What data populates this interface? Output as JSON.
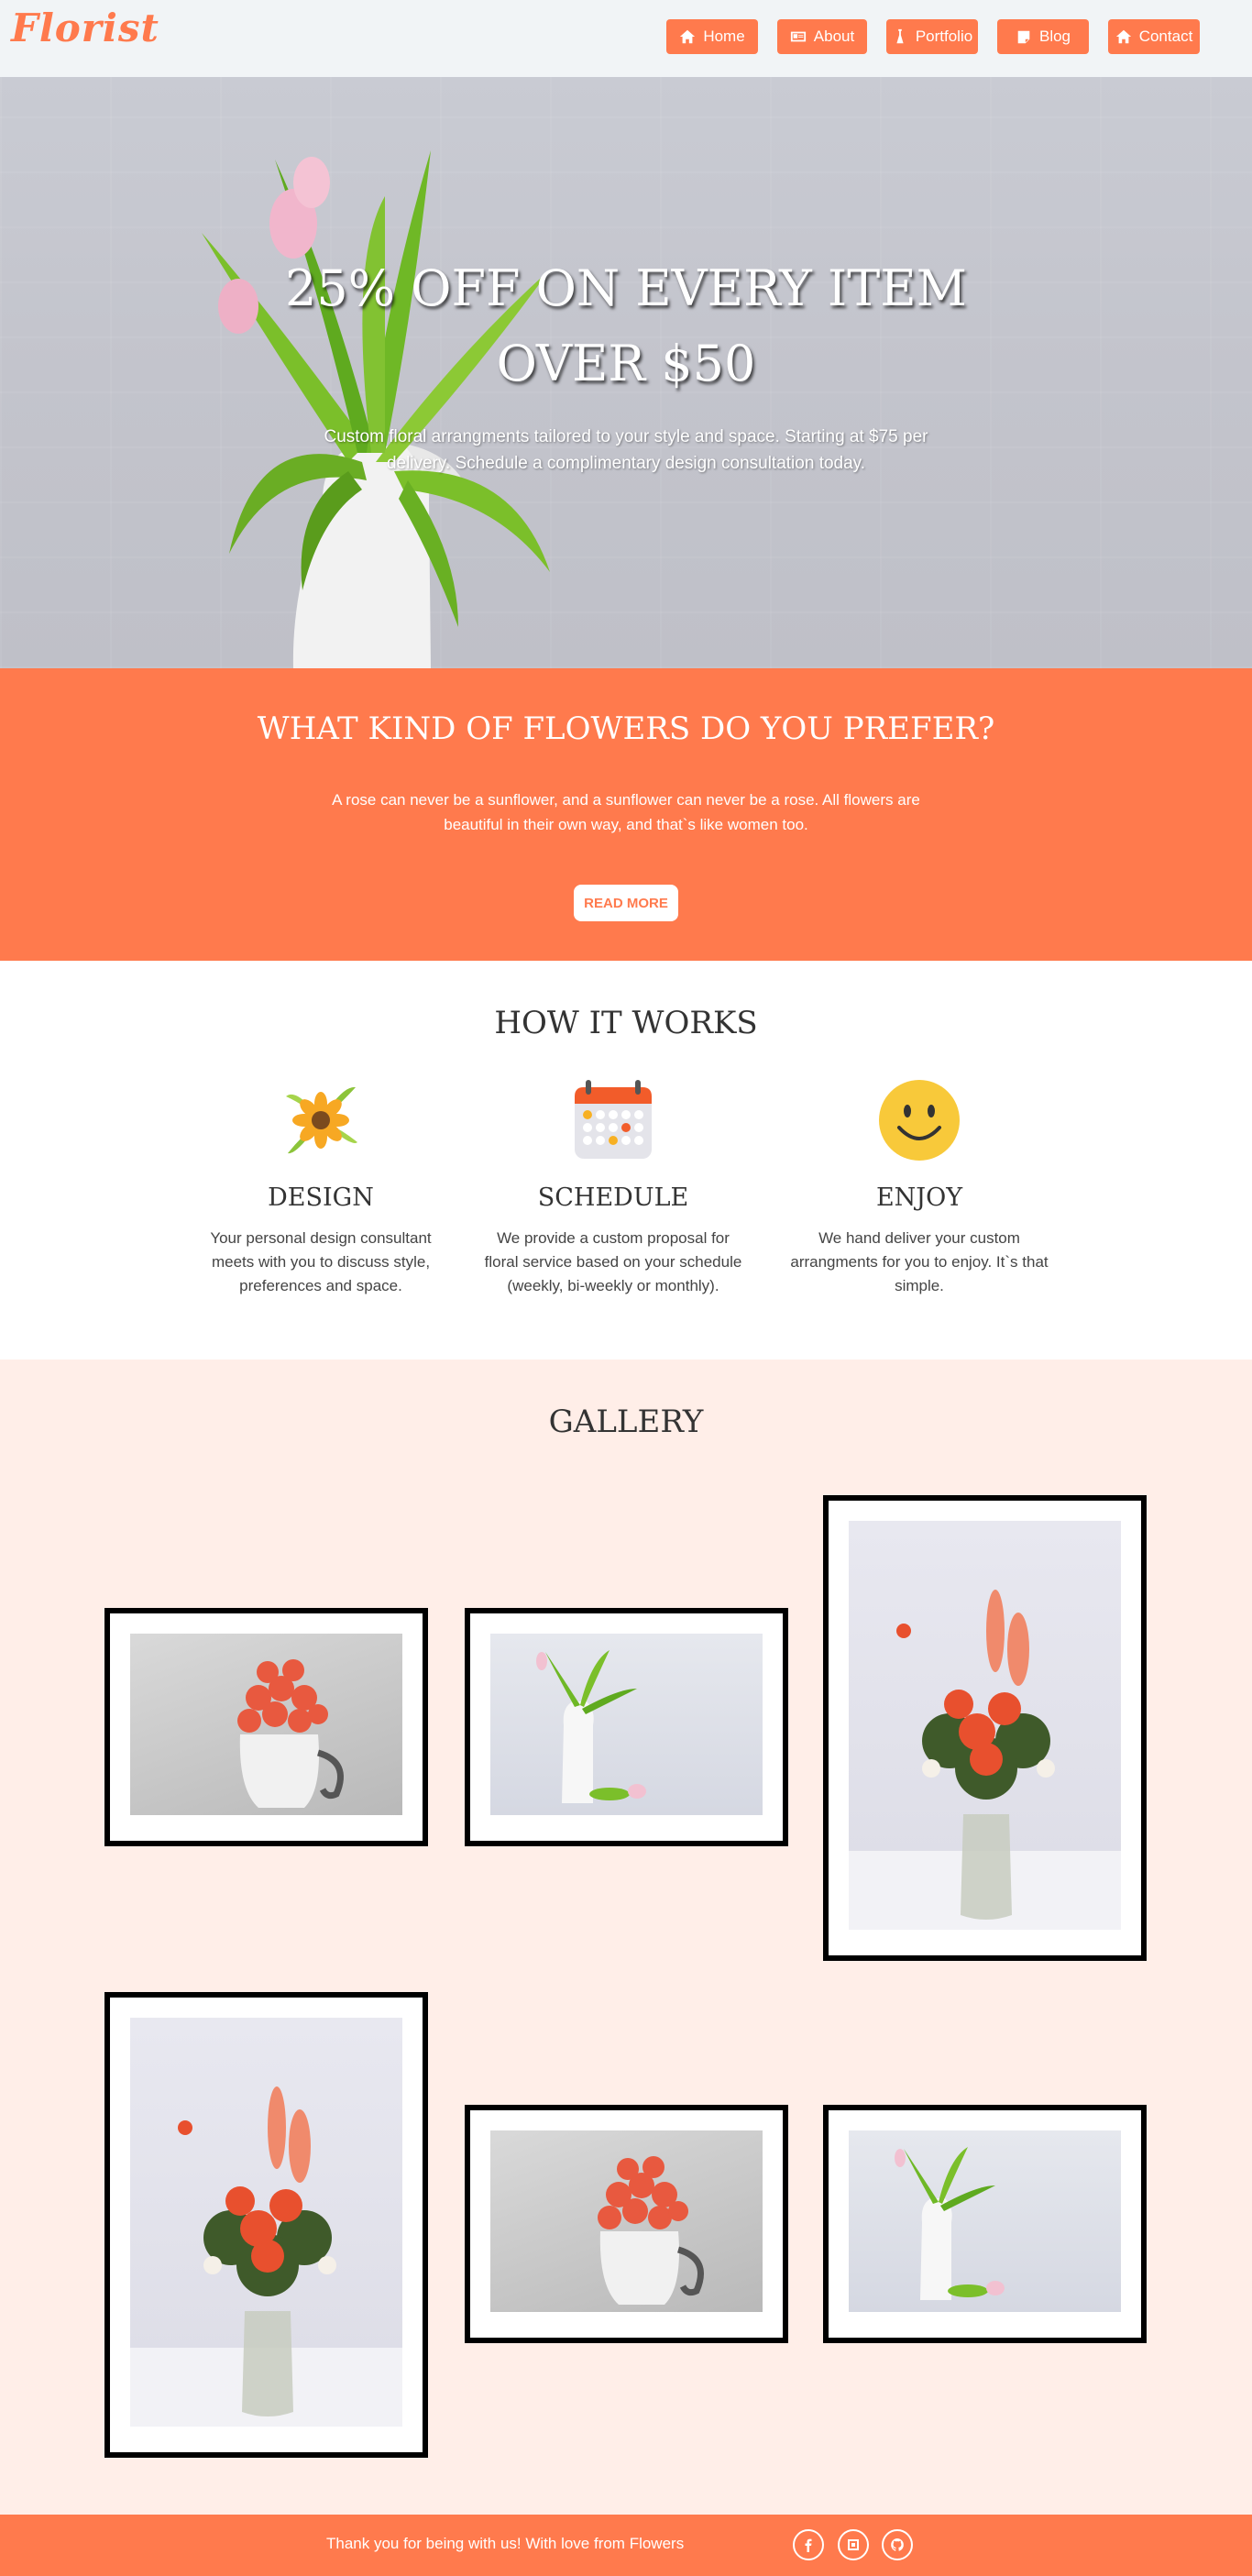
{
  "brand": {
    "logo": "Florist",
    "accent": "#ff7a4d"
  },
  "nav": {
    "items": [
      {
        "label": "Home",
        "icon": "home-icon"
      },
      {
        "label": "About",
        "icon": "id-card-icon"
      },
      {
        "label": "Portfolio",
        "icon": "flask-icon"
      },
      {
        "label": "Blog",
        "icon": "note-icon"
      },
      {
        "label": "Contact",
        "icon": "home-icon"
      }
    ]
  },
  "hero": {
    "title_line1": "25% OFF ON EVERY ITEM",
    "title_line2": "OVER $50",
    "subtitle": "Custom floral arrangments tailored to your style and space. Starting at $75 per delivery. Schedule a complimentary design consultation today."
  },
  "promo": {
    "title": "WHAT KIND OF FLOWERS DO YOU PREFER?",
    "text": "A rose can never be a sunflower, and a sunflower can never be a rose. All flowers are beautiful in their own way, and that`s like women too.",
    "button": "READ MORE"
  },
  "how": {
    "title": "HOW IT WORKS",
    "steps": [
      {
        "title": "DESIGN",
        "text": "Your personal design consultant meets with you to discuss style, preferences and space.",
        "icon": "flower-icon"
      },
      {
        "title": "SCHEDULE",
        "text": "We provide a custom proposal for floral service based on your schedule (weekly, bi-weekly or monthly).",
        "icon": "calendar-icon"
      },
      {
        "title": "ENJOY",
        "text": "We hand deliver your custom arrangments for you to enjoy. It`s that simple.",
        "icon": "smiley-icon"
      }
    ]
  },
  "gallery": {
    "title": "GALLERY"
  },
  "footer": {
    "text": "Thank you for being with us! With love from Flowers",
    "social": [
      "facebook-icon",
      "square-icon",
      "github-icon"
    ]
  }
}
